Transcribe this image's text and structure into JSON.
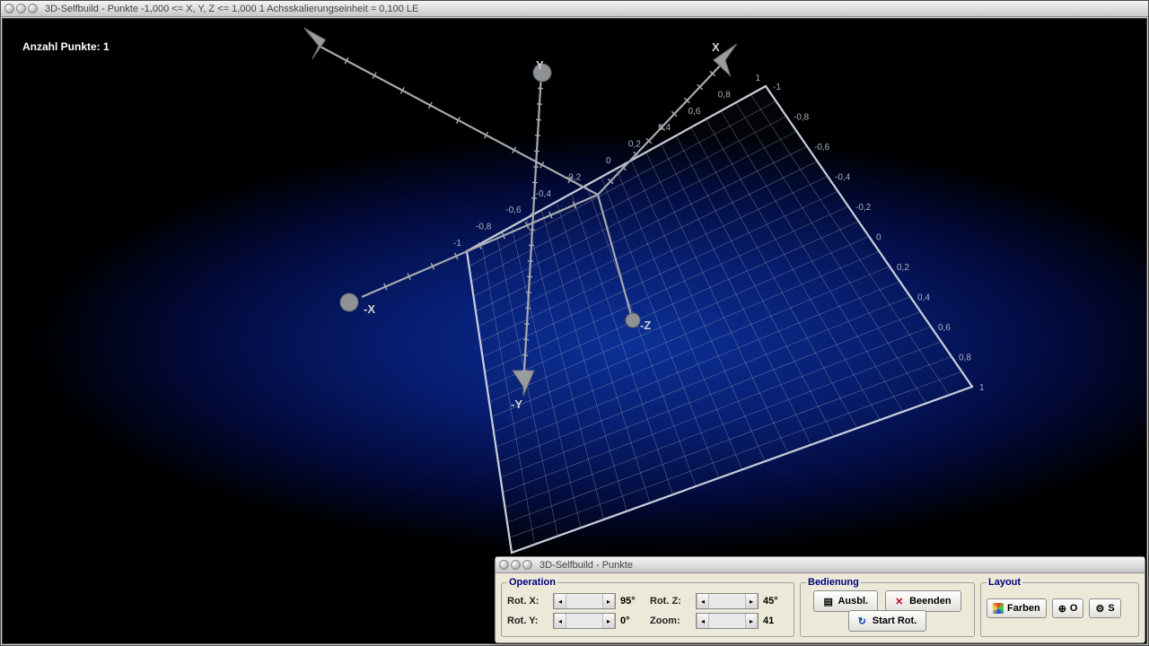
{
  "window": {
    "title": "3D-Selfbuild - Punkte   -1,000 <= X, Y, Z <= 1,000   1 Achsskalierungseinheit = 0,100 LE"
  },
  "viewport": {
    "point_count_label": "Anzahl Punkte: 1",
    "axis_x_label": "X",
    "axis_neg_z_label": "-Z",
    "axis_neg_x_label": "-X",
    "axis_y_label": "Y",
    "axis_neg_y_label": "-Y",
    "grid_ticks_top": [
      "-1",
      "-0,8",
      "-0,6",
      "-0,4",
      "-0,2",
      "0",
      "0,2",
      "0,4",
      "0,6",
      "0,8",
      "1"
    ],
    "grid_ticks_right": [
      "-1",
      "-0,8",
      "-0,6",
      "-0,4",
      "-0,2",
      "0",
      "0,2",
      "0,4",
      "0,6",
      "0,8",
      "1"
    ]
  },
  "panel": {
    "title": "3D-Selfbuild - Punkte",
    "operation": {
      "legend": "Operation",
      "rot_x_label": "Rot. X:",
      "rot_x_value": "95°",
      "rot_y_label": "Rot. Y:",
      "rot_y_value": "0°",
      "rot_z_label": "Rot. Z:",
      "rot_z_value": "45°",
      "zoom_label": "Zoom:",
      "zoom_value": "41"
    },
    "bedienung": {
      "legend": "Bedienung",
      "ausbl_label": "Ausbl.",
      "beenden_label": "Beenden",
      "start_rot_label": "Start Rot."
    },
    "layout": {
      "legend": "Layout",
      "farben_label": "Farben",
      "o_label": "O",
      "s_label": "S"
    }
  },
  "chart_data": {
    "type": "3d-scatter",
    "title": "3D-Selfbuild - Punkte",
    "x_range": [
      -1,
      1
    ],
    "y_range": [
      -1,
      1
    ],
    "z_range": [
      -1,
      1
    ],
    "axis_unit": 0.1,
    "rotation": {
      "x": 95,
      "y": 0,
      "z": 45
    },
    "zoom": 41,
    "points": [
      {
        "x": 0,
        "y": 0,
        "z": 0
      }
    ],
    "grid_plane": "xz",
    "grid_tick_step": 0.1,
    "grid_label_step": 0.2
  }
}
